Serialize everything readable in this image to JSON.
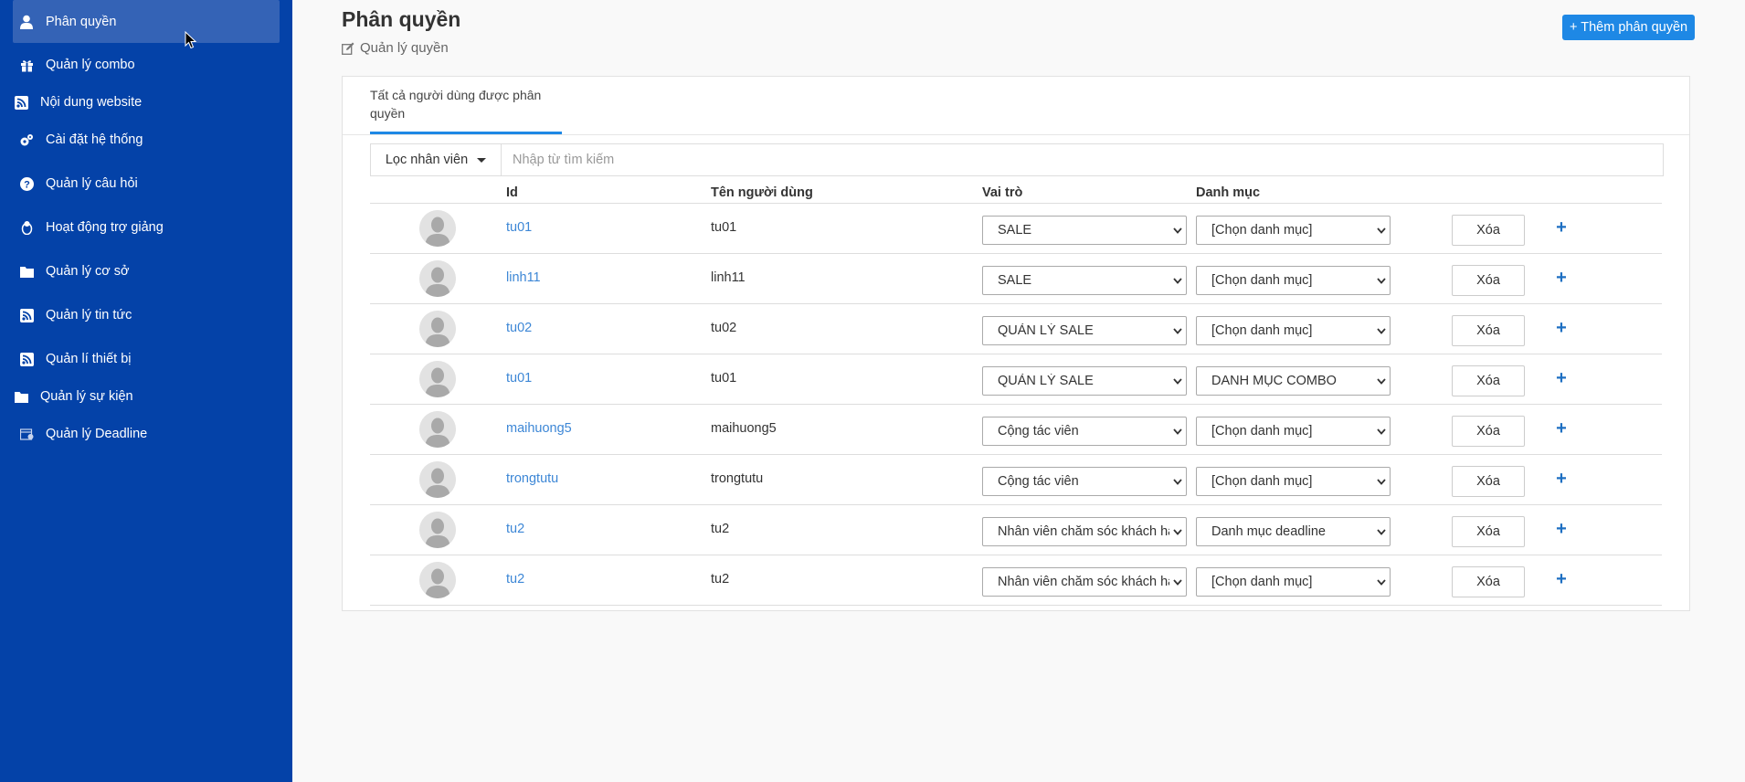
{
  "sidebar": {
    "items": [
      {
        "label": "Phân quyền",
        "icon": "user-icon"
      },
      {
        "label": "Quản lý combo",
        "icon": "gift-icon"
      },
      {
        "label": "Nội dung website",
        "icon": "rss-icon"
      },
      {
        "label": "Cài đặt hệ thống",
        "icon": "gears-icon"
      },
      {
        "label": "Quản lý câu hỏi",
        "icon": "question-icon"
      },
      {
        "label": "Hoạt động trợ giảng",
        "icon": "linux-icon"
      },
      {
        "label": "Quản lý cơ sở",
        "icon": "folder-icon"
      },
      {
        "label": "Quản lý tin tức",
        "icon": "rss-icon"
      },
      {
        "label": "Quản lí thiết bị",
        "icon": "rss-icon"
      },
      {
        "label": "Quản lý sự kiện",
        "icon": "folder-icon"
      },
      {
        "label": "Quản lý Deadline",
        "icon": "calendar-icon"
      }
    ]
  },
  "header": {
    "title": "Phân quyền",
    "subtitle": "Quản lý quyền",
    "add_button": "+ Thêm phân quyền"
  },
  "tabs": [
    {
      "label": "Tất cả người dùng được phân quyền"
    }
  ],
  "filter": {
    "button_label": "Lọc nhân viên",
    "placeholder": "Nhập từ tìm kiếm"
  },
  "table": {
    "headers": {
      "id": "Id",
      "username": "Tên người dùng",
      "role": "Vai trò",
      "category": "Danh mục"
    },
    "delete_label": "Xóa",
    "add_label": "+",
    "rows": [
      {
        "id": "tu01",
        "username": "tu01",
        "role": "SALE",
        "category": "[Chọn danh mục]"
      },
      {
        "id": "linh11",
        "username": "linh11",
        "role": "SALE",
        "category": "[Chọn danh mục]"
      },
      {
        "id": "tu02",
        "username": "tu02",
        "role": "QUẢN LÝ SALE",
        "category": "[Chọn danh mục]"
      },
      {
        "id": "tu01",
        "username": "tu01",
        "role": "QUẢN LÝ SALE",
        "category": "DANH MỤC COMBO"
      },
      {
        "id": "maihuong5",
        "username": "maihuong5",
        "role": "Cộng tác viên",
        "category": "[Chọn danh mục]"
      },
      {
        "id": "trongtutu",
        "username": "trongtutu",
        "role": "Cộng tác viên",
        "category": "[Chọn danh mục]"
      },
      {
        "id": "tu2",
        "username": "tu2",
        "role": "Nhân viên chăm sóc khách hàng",
        "category": "Danh mục deadline"
      },
      {
        "id": "tu2",
        "username": "tu2",
        "role": "Nhân viên chăm sóc khách hàng",
        "category": "[Chọn danh mục]"
      }
    ]
  },
  "colors": {
    "sidebar": "#0442a8",
    "sidebar_active": "#3463b6",
    "accent": "#1e88e5",
    "link": "#3d87d6"
  }
}
